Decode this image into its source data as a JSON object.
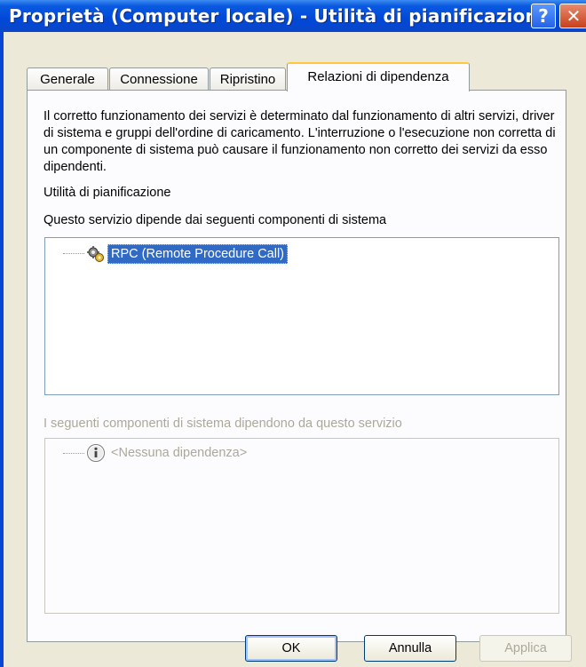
{
  "window": {
    "title": "Proprietà (Computer locale) - Utilità di pianificazione",
    "help_glyph": "?",
    "close_glyph": "✕"
  },
  "tabs": [
    {
      "label": "Generale",
      "active": false
    },
    {
      "label": "Connessione",
      "active": false
    },
    {
      "label": "Ripristino",
      "active": false
    },
    {
      "label": "Relazioni di dipendenza",
      "active": true
    }
  ],
  "panel": {
    "description": "Il corretto funzionamento dei servizi è determinato dal funzionamento di altri servizi, driver di sistema e gruppi dell'ordine di caricamento. L'interruzione o l'esecuzione non corretta di un componente di sistema può causare il funzionamento non corretto dei servizi da esso dipendenti.",
    "service_name": "Utilità di pianificazione",
    "depends_on_label": "Questo servizio dipende dai seguenti componenti di sistema",
    "depends_on_items": [
      "RPC (Remote Procedure Call)"
    ],
    "dependents_label": "I seguenti componenti di sistema dipendono da questo servizio",
    "dependents_items": [
      "<Nessuna dipendenza>"
    ]
  },
  "buttons": {
    "ok": "OK",
    "cancel": "Annulla",
    "apply": "Applica"
  },
  "icons": {
    "service": "gears-icon",
    "info": "info-icon"
  },
  "colors": {
    "selection": "#316ac5",
    "titlebar": "#0a4ad8",
    "face": "#ece9d8"
  }
}
